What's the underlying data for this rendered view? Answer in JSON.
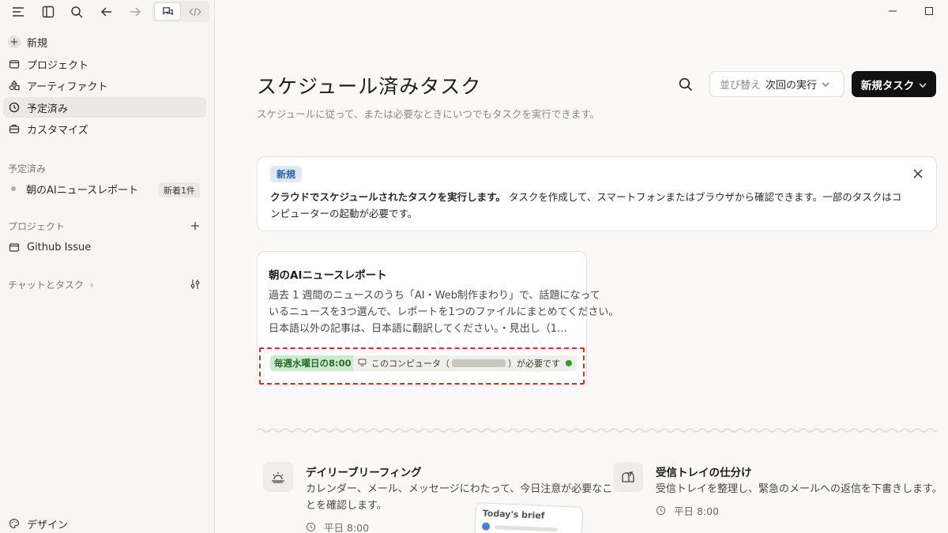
{
  "sidebar": {
    "nav": [
      {
        "label": "新規",
        "icon": "plus-icon"
      },
      {
        "label": "プロジェクト",
        "icon": "folder-icon"
      },
      {
        "label": "アーティファクト",
        "icon": "shapes-icon"
      },
      {
        "label": "予定済み",
        "icon": "clock-icon",
        "active": true
      },
      {
        "label": "カスタマイズ",
        "icon": "briefcase-icon"
      }
    ],
    "scheduled_section": "予定済み",
    "scheduled_items": [
      {
        "label": "朝のAIニュースレポート",
        "badge": "新着1件"
      }
    ],
    "projects_section": "プロジェクト",
    "project_items": [
      {
        "label": "Github Issue"
      }
    ],
    "chat_section": "チャットとタスク",
    "footer_item": "デザイン"
  },
  "header": {
    "title": "スケジュール済みタスク",
    "subtitle": "スケジュールに従って、または必要なときにいつでもタスクを実行できます。",
    "sort_key": "並び替え",
    "sort_value": "次回の実行",
    "new_task_label": "新規タスク"
  },
  "banner": {
    "pill": "新規",
    "bold": "クラウドでスケジュールされたタスクを実行します。",
    "text": "タスクを作成して、スマートフォンまたはブラウザから確認できます。一部のタスクはコンピューターの起動が必要です。"
  },
  "task_card": {
    "title": "朝のAIニュースレポート",
    "desc_line1": "過去 1 週間のニュースのうち「AI・Web制作まわり」で、話題になって",
    "desc_line2": "いるニュースを3つ選んで、レポートを1つのファイルにまとめてください。",
    "desc_line3": "日本語以外の記事は、日本語に翻訳してください。・見出し（1…",
    "schedule_tag": "毎週水曜日の8:00",
    "requirement_prefix": "このコンピュータ（",
    "requirement_suffix": "）が必要です",
    "status_color": "#2d9b2d"
  },
  "templates": [
    {
      "name": "デイリーブリーフィング",
      "desc_line1": "カレンダー、メール、メッセージにわたって、今日注意が必要なこ",
      "desc_line2": "とを確認します。",
      "schedule": "平日 8:00",
      "icon": "sunrise-icon",
      "preview_title": "Today's brief"
    },
    {
      "name": "受信トレイの仕分け",
      "desc_line1": "受信トレイを整理し、緊急のメールへの返信を下書きします。",
      "schedule": "平日 8:00",
      "icon": "mailbox-icon"
    }
  ],
  "colors": {
    "accent_dark": "#111111",
    "new_pill_bg": "#dce9f8",
    "schedule_tag_bg": "#cfe9cf",
    "highlight_border": "#e02828"
  }
}
